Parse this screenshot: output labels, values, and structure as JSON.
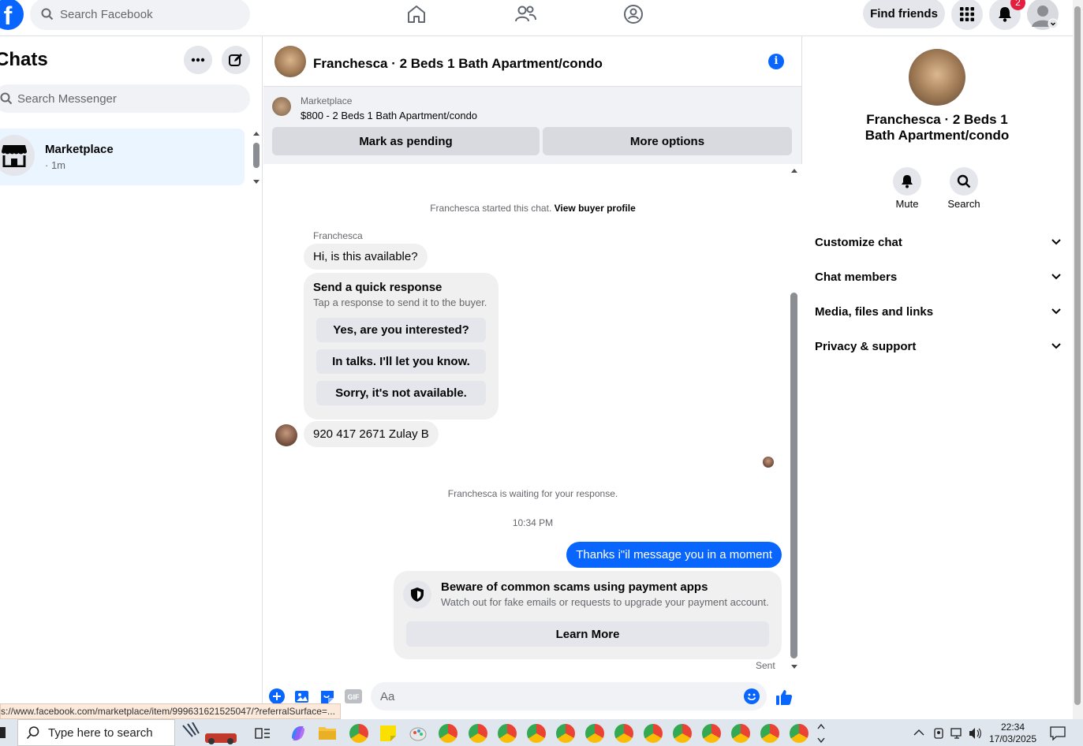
{
  "topbar": {
    "logo": "f",
    "search_placeholder": "Search Facebook",
    "find_friends": "Find friends",
    "notification_count": "2",
    "icons": [
      "home-icon",
      "friends-icon",
      "groups-icon",
      "menu-grid-icon",
      "bell-icon",
      "account-avatar"
    ]
  },
  "left": {
    "title": "Chats",
    "search_placeholder": "Search Messenger",
    "chat_items": [
      {
        "name": "Marketplace",
        "time": "· 1m"
      }
    ]
  },
  "conversation": {
    "title": "Franchesca · 2 Beds 1 Bath Apartment/condo",
    "marketplace_label": "Marketplace",
    "listing": "$800 - 2 Beds 1 Bath Apartment/condo",
    "mark_pending": "Mark as pending",
    "more_options": "More options",
    "started_text": "Franchesca started this chat.",
    "view_buyer_profile": "View buyer profile",
    "sender_name": "Franchesca",
    "first_message": "Hi, is this available?",
    "quick_response": {
      "title": "Send a quick response",
      "subtitle": "Tap a response to send it to the buyer.",
      "options": [
        "Yes, are you interested?",
        "In talks. I'll let you know.",
        "Sorry, it's not available."
      ]
    },
    "second_message": "920 417 2671 Zulay B",
    "waiting_text": "Franchesca is waiting for your response.",
    "timestamp": "10:34 PM",
    "outgoing_message": "Thanks i\"il message you in a moment",
    "scam_card": {
      "title": "Beware of common scams using payment apps",
      "subtitle": "Watch out for fake emails or requests to upgrade your payment account.",
      "button": "Learn More"
    },
    "sent_status": "Sent",
    "composer_placeholder": "Aa",
    "gif_label": "GIF"
  },
  "right": {
    "title": "Franchesca · 2 Beds 1 Bath Apartment/condo",
    "mute_label": "Mute",
    "search_label": "Search",
    "sections": [
      "Customize chat",
      "Chat members",
      "Media, files and links",
      "Privacy & support"
    ]
  },
  "status_url": "s://www.facebook.com/marketplace/item/999631621525047/?referralSurface=...",
  "taskbar": {
    "search_placeholder": "Type here to search",
    "time": "22:34",
    "date": "17/03/2025"
  },
  "colors": {
    "accent": "#0866ff",
    "selected_chat": "#ebf5ff",
    "bubble_in": "#f0f0f0",
    "badge": "#e41e3f"
  }
}
